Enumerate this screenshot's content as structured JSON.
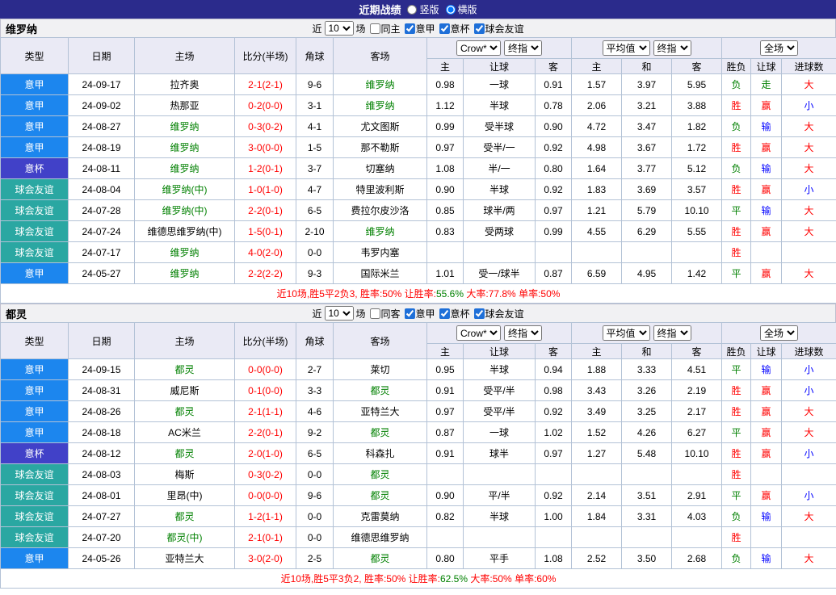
{
  "palette": {
    "red": "#FF0000",
    "green": "#008000",
    "blue": "#0000FF",
    "topbar_bg": "#2B2B8C",
    "type_serieA": "#1C86EE",
    "type_cup": "#4141C8",
    "type_friendly": "#2AA7A2"
  },
  "topbar": {
    "title": "近期战绩",
    "layout_options": [
      {
        "label": "竖版",
        "selected": false
      },
      {
        "label": "横版",
        "selected": true
      }
    ]
  },
  "headers": {
    "type": "类型",
    "date": "日期",
    "home": "主场",
    "score": "比分(半场)",
    "corners": "角球",
    "away": "客场",
    "asian_source_select": "Crow*",
    "asian_final_select": "终指",
    "euro_source_select": "平均值",
    "euro_final_select": "终指",
    "result_select": "全场",
    "sub": [
      "主",
      "让球",
      "客",
      "主",
      "和",
      "客",
      "胜负",
      "让球",
      "进球数"
    ]
  },
  "sections": [
    {
      "team": "维罗纳",
      "filter": {
        "prefix": "近",
        "count": "10",
        "suffix": "场",
        "checkboxes": [
          {
            "label": "同主",
            "checked": false
          },
          {
            "label": "意甲",
            "checked": true
          },
          {
            "label": "意杯",
            "checked": true
          },
          {
            "label": "球会友谊",
            "checked": true
          }
        ]
      },
      "rows": [
        {
          "type": "意甲",
          "type_key": "serieA",
          "date": "24-09-17",
          "home": "拉齐奥",
          "home_focus": false,
          "score": "2-1(2-1)",
          "corners": "9-6",
          "away": "维罗纳",
          "away_focus": true,
          "asian": [
            "0.98",
            "一球",
            "0.91"
          ],
          "euro": [
            "1.57",
            "3.97",
            "5.95"
          ],
          "outcome": {
            "t": "负",
            "c": "green"
          },
          "handicap": {
            "t": "走",
            "c": "green"
          },
          "goals": {
            "t": "大",
            "c": "red"
          }
        },
        {
          "type": "意甲",
          "type_key": "serieA",
          "date": "24-09-02",
          "home": "热那亚",
          "home_focus": false,
          "score": "0-2(0-0)",
          "corners": "3-1",
          "away": "维罗纳",
          "away_focus": true,
          "asian": [
            "1.12",
            "半球",
            "0.78"
          ],
          "euro": [
            "2.06",
            "3.21",
            "3.88"
          ],
          "outcome": {
            "t": "胜",
            "c": "red"
          },
          "handicap": {
            "t": "赢",
            "c": "red"
          },
          "goals": {
            "t": "小",
            "c": "blue"
          }
        },
        {
          "type": "意甲",
          "type_key": "serieA",
          "date": "24-08-27",
          "home": "维罗纳",
          "home_focus": true,
          "score": "0-3(0-2)",
          "corners": "4-1",
          "away": "尤文图斯",
          "away_focus": false,
          "asian": [
            "0.99",
            "受半球",
            "0.90"
          ],
          "euro": [
            "4.72",
            "3.47",
            "1.82"
          ],
          "outcome": {
            "t": "负",
            "c": "green"
          },
          "handicap": {
            "t": "输",
            "c": "blue"
          },
          "goals": {
            "t": "大",
            "c": "red"
          }
        },
        {
          "type": "意甲",
          "type_key": "serieA",
          "date": "24-08-19",
          "home": "维罗纳",
          "home_focus": true,
          "score": "3-0(0-0)",
          "corners": "1-5",
          "away": "那不勒斯",
          "away_focus": false,
          "asian": [
            "0.97",
            "受半/一",
            "0.92"
          ],
          "euro": [
            "4.98",
            "3.67",
            "1.72"
          ],
          "outcome": {
            "t": "胜",
            "c": "red"
          },
          "handicap": {
            "t": "赢",
            "c": "red"
          },
          "goals": {
            "t": "大",
            "c": "red"
          }
        },
        {
          "type": "意杯",
          "type_key": "cup",
          "date": "24-08-11",
          "home": "维罗纳",
          "home_focus": true,
          "score": "1-2(0-1)",
          "corners": "3-7",
          "away": "切塞纳",
          "away_focus": false,
          "asian": [
            "1.08",
            "半/一",
            "0.80"
          ],
          "euro": [
            "1.64",
            "3.77",
            "5.12"
          ],
          "outcome": {
            "t": "负",
            "c": "green"
          },
          "handicap": {
            "t": "输",
            "c": "blue"
          },
          "goals": {
            "t": "大",
            "c": "red"
          }
        },
        {
          "type": "球会友谊",
          "type_key": "friendly",
          "date": "24-08-04",
          "home": "维罗纳(中)",
          "home_focus": true,
          "score": "1-0(1-0)",
          "corners": "4-7",
          "away": "特里波利斯",
          "away_focus": false,
          "asian": [
            "0.90",
            "半球",
            "0.92"
          ],
          "euro": [
            "1.83",
            "3.69",
            "3.57"
          ],
          "outcome": {
            "t": "胜",
            "c": "red"
          },
          "handicap": {
            "t": "赢",
            "c": "red"
          },
          "goals": {
            "t": "小",
            "c": "blue"
          }
        },
        {
          "type": "球会友谊",
          "type_key": "friendly",
          "date": "24-07-28",
          "home": "维罗纳(中)",
          "home_focus": true,
          "score": "2-2(0-1)",
          "corners": "6-5",
          "away": "费拉尔皮沙洛",
          "away_focus": false,
          "asian": [
            "0.85",
            "球半/两",
            "0.97"
          ],
          "euro": [
            "1.21",
            "5.79",
            "10.10"
          ],
          "outcome": {
            "t": "平",
            "c": "green"
          },
          "handicap": {
            "t": "输",
            "c": "blue"
          },
          "goals": {
            "t": "大",
            "c": "red"
          }
        },
        {
          "type": "球会友谊",
          "type_key": "friendly",
          "date": "24-07-24",
          "home": "维德思维罗纳(中)",
          "home_focus": false,
          "score": "1-5(0-1)",
          "corners": "2-10",
          "away": "维罗纳",
          "away_focus": true,
          "asian": [
            "0.83",
            "受两球",
            "0.99"
          ],
          "euro": [
            "4.55",
            "6.29",
            "5.55"
          ],
          "outcome": {
            "t": "胜",
            "c": "red"
          },
          "handicap": {
            "t": "赢",
            "c": "red"
          },
          "goals": {
            "t": "大",
            "c": "red"
          }
        },
        {
          "type": "球会友谊",
          "type_key": "friendly",
          "date": "24-07-17",
          "home": "维罗纳",
          "home_focus": true,
          "score": "4-0(2-0)",
          "corners": "0-0",
          "away": "韦罗内塞",
          "away_focus": false,
          "asian": [
            "",
            "",
            ""
          ],
          "euro": [
            "",
            "",
            ""
          ],
          "outcome": {
            "t": "胜",
            "c": "red"
          },
          "handicap": {
            "t": "",
            "c": ""
          },
          "goals": {
            "t": "",
            "c": ""
          }
        },
        {
          "type": "意甲",
          "type_key": "serieA",
          "date": "24-05-27",
          "home": "维罗纳",
          "home_focus": true,
          "score": "2-2(2-2)",
          "corners": "9-3",
          "away": "国际米兰",
          "away_focus": false,
          "asian": [
            "1.01",
            "受一/球半",
            "0.87"
          ],
          "euro": [
            "6.59",
            "4.95",
            "1.42"
          ],
          "outcome": {
            "t": "平",
            "c": "green"
          },
          "handicap": {
            "t": "赢",
            "c": "red"
          },
          "goals": {
            "t": "大",
            "c": "red"
          }
        }
      ],
      "summary": [
        {
          "text": "近10场,胜5平2负3, 胜率:",
          "color": "red"
        },
        {
          "text": "50%",
          "color": "red"
        },
        {
          "text": " 让胜率:",
          "color": "red"
        },
        {
          "text": "55.6%",
          "color": "green"
        },
        {
          "text": " 大率:",
          "color": "red"
        },
        {
          "text": "77.8%",
          "color": "red"
        },
        {
          "text": " 单率:",
          "color": "red"
        },
        {
          "text": "50%",
          "color": "red"
        }
      ]
    },
    {
      "team": "都灵",
      "filter": {
        "prefix": "近",
        "count": "10",
        "suffix": "场",
        "checkboxes": [
          {
            "label": "同客",
            "checked": false
          },
          {
            "label": "意甲",
            "checked": true
          },
          {
            "label": "意杯",
            "checked": true
          },
          {
            "label": "球会友谊",
            "checked": true
          }
        ]
      },
      "rows": [
        {
          "type": "意甲",
          "type_key": "serieA",
          "date": "24-09-15",
          "home": "都灵",
          "home_focus": true,
          "score": "0-0(0-0)",
          "corners": "2-7",
          "away": "莱切",
          "away_focus": false,
          "asian": [
            "0.95",
            "半球",
            "0.94"
          ],
          "euro": [
            "1.88",
            "3.33",
            "4.51"
          ],
          "outcome": {
            "t": "平",
            "c": "green"
          },
          "handicap": {
            "t": "输",
            "c": "blue"
          },
          "goals": {
            "t": "小",
            "c": "blue"
          }
        },
        {
          "type": "意甲",
          "type_key": "serieA",
          "date": "24-08-31",
          "home": "威尼斯",
          "home_focus": false,
          "score": "0-1(0-0)",
          "corners": "3-3",
          "away": "都灵",
          "away_focus": true,
          "asian": [
            "0.91",
            "受平/半",
            "0.98"
          ],
          "euro": [
            "3.43",
            "3.26",
            "2.19"
          ],
          "outcome": {
            "t": "胜",
            "c": "red"
          },
          "handicap": {
            "t": "赢",
            "c": "red"
          },
          "goals": {
            "t": "小",
            "c": "blue"
          }
        },
        {
          "type": "意甲",
          "type_key": "serieA",
          "date": "24-08-26",
          "home": "都灵",
          "home_focus": true,
          "score": "2-1(1-1)",
          "corners": "4-6",
          "away": "亚特兰大",
          "away_focus": false,
          "asian": [
            "0.97",
            "受平/半",
            "0.92"
          ],
          "euro": [
            "3.49",
            "3.25",
            "2.17"
          ],
          "outcome": {
            "t": "胜",
            "c": "red"
          },
          "handicap": {
            "t": "赢",
            "c": "red"
          },
          "goals": {
            "t": "大",
            "c": "red"
          }
        },
        {
          "type": "意甲",
          "type_key": "serieA",
          "date": "24-08-18",
          "home": "AC米兰",
          "home_focus": false,
          "score": "2-2(0-1)",
          "corners": "9-2",
          "away": "都灵",
          "away_focus": true,
          "asian": [
            "0.87",
            "一球",
            "1.02"
          ],
          "euro": [
            "1.52",
            "4.26",
            "6.27"
          ],
          "outcome": {
            "t": "平",
            "c": "green"
          },
          "handicap": {
            "t": "赢",
            "c": "red"
          },
          "goals": {
            "t": "大",
            "c": "red"
          }
        },
        {
          "type": "意杯",
          "type_key": "cup",
          "date": "24-08-12",
          "home": "都灵",
          "home_focus": true,
          "score": "2-0(1-0)",
          "corners": "6-5",
          "away": "科森扎",
          "away_focus": false,
          "asian": [
            "0.91",
            "球半",
            "0.97"
          ],
          "euro": [
            "1.27",
            "5.48",
            "10.10"
          ],
          "outcome": {
            "t": "胜",
            "c": "red"
          },
          "handicap": {
            "t": "赢",
            "c": "red"
          },
          "goals": {
            "t": "小",
            "c": "blue"
          }
        },
        {
          "type": "球会友谊",
          "type_key": "friendly",
          "date": "24-08-03",
          "home": "梅斯",
          "home_focus": false,
          "score": "0-3(0-2)",
          "corners": "0-0",
          "away": "都灵",
          "away_focus": true,
          "asian": [
            "",
            "",
            ""
          ],
          "euro": [
            "",
            "",
            ""
          ],
          "outcome": {
            "t": "胜",
            "c": "red"
          },
          "handicap": {
            "t": "",
            "c": ""
          },
          "goals": {
            "t": "",
            "c": ""
          }
        },
        {
          "type": "球会友谊",
          "type_key": "friendly",
          "date": "24-08-01",
          "home": "里昂(中)",
          "home_focus": false,
          "score": "0-0(0-0)",
          "corners": "9-6",
          "away": "都灵",
          "away_focus": true,
          "asian": [
            "0.90",
            "平/半",
            "0.92"
          ],
          "euro": [
            "2.14",
            "3.51",
            "2.91"
          ],
          "outcome": {
            "t": "平",
            "c": "green"
          },
          "handicap": {
            "t": "赢",
            "c": "red"
          },
          "goals": {
            "t": "小",
            "c": "blue"
          }
        },
        {
          "type": "球会友谊",
          "type_key": "friendly",
          "date": "24-07-27",
          "home": "都灵",
          "home_focus": true,
          "score": "1-2(1-1)",
          "corners": "0-0",
          "away": "克雷莫纳",
          "away_focus": false,
          "asian": [
            "0.82",
            "半球",
            "1.00"
          ],
          "euro": [
            "1.84",
            "3.31",
            "4.03"
          ],
          "outcome": {
            "t": "负",
            "c": "green"
          },
          "handicap": {
            "t": "输",
            "c": "blue"
          },
          "goals": {
            "t": "大",
            "c": "red"
          }
        },
        {
          "type": "球会友谊",
          "type_key": "friendly",
          "date": "24-07-20",
          "home": "都灵(中)",
          "home_focus": true,
          "score": "2-1(0-1)",
          "corners": "0-0",
          "away": "维德思维罗纳",
          "away_focus": false,
          "asian": [
            "",
            "",
            ""
          ],
          "euro": [
            "",
            "",
            ""
          ],
          "outcome": {
            "t": "胜",
            "c": "red"
          },
          "handicap": {
            "t": "",
            "c": ""
          },
          "goals": {
            "t": "",
            "c": ""
          }
        },
        {
          "type": "意甲",
          "type_key": "serieA",
          "date": "24-05-26",
          "home": "亚特兰大",
          "home_focus": false,
          "score": "3-0(2-0)",
          "corners": "2-5",
          "away": "都灵",
          "away_focus": true,
          "asian": [
            "0.80",
            "平手",
            "1.08"
          ],
          "euro": [
            "2.52",
            "3.50",
            "2.68"
          ],
          "outcome": {
            "t": "负",
            "c": "green"
          },
          "handicap": {
            "t": "输",
            "c": "blue"
          },
          "goals": {
            "t": "大",
            "c": "red"
          }
        }
      ],
      "summary": [
        {
          "text": "近10场,胜5平3负2, 胜率:",
          "color": "red"
        },
        {
          "text": "50%",
          "color": "red"
        },
        {
          "text": " 让胜率:",
          "color": "red"
        },
        {
          "text": "62.5%",
          "color": "green"
        },
        {
          "text": " 大率:",
          "color": "red"
        },
        {
          "text": "50%",
          "color": "red"
        },
        {
          "text": " 单率:",
          "color": "red"
        },
        {
          "text": "60%",
          "color": "red"
        }
      ]
    }
  ]
}
